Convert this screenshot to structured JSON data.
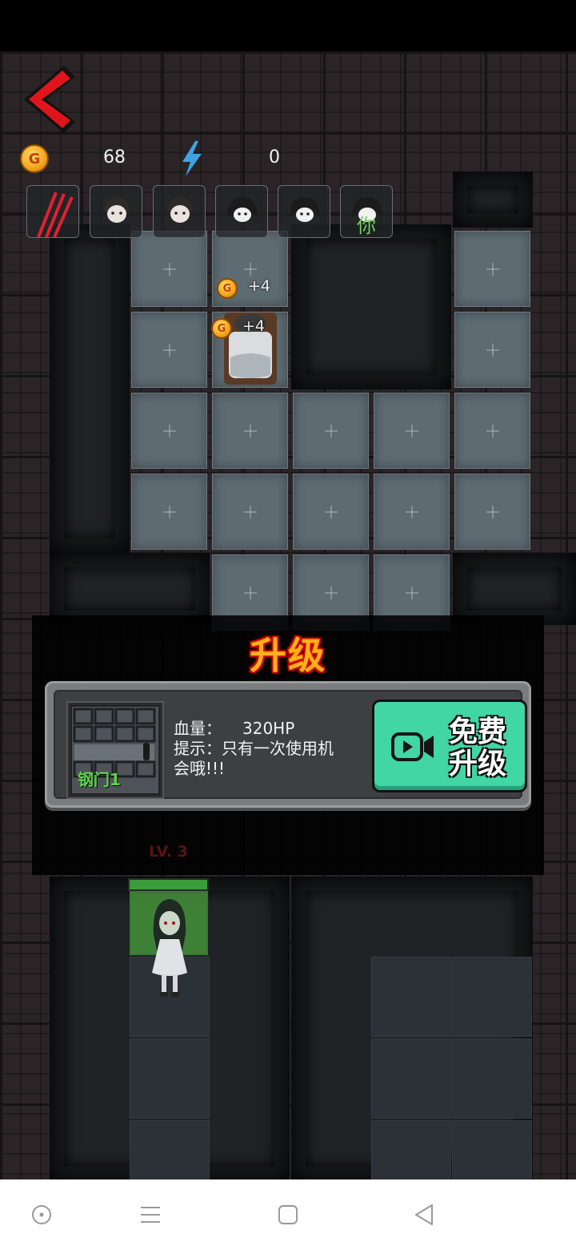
{
  "hud": {
    "coin_icon_label": "G",
    "coins": "68",
    "energy": "0",
    "icons": [
      "back-arrow-icon",
      "coin-icon",
      "lightning-bolt-icon"
    ],
    "character_slots": [
      {
        "icon": "claw-slash-icon"
      },
      {
        "icon": "girl-face-icon"
      },
      {
        "icon": "girl-face-icon"
      },
      {
        "icon": "ghost-face-icon"
      },
      {
        "icon": "ghost-face-icon"
      },
      {
        "icon": "ghost-face-icon",
        "label": "你"
      }
    ]
  },
  "map": {
    "coin_gains": [
      "+4",
      "+4"
    ],
    "small_coin_label": "G"
  },
  "upgrade_dialog": {
    "title": "升级",
    "item_name": "钢门1",
    "hp_label": "血量：",
    "hp_value": "320HP",
    "hint_line1": "提示：只有一次使用机",
    "hint_line2": "会哦!!!",
    "button_line1": "免费",
    "button_line2": "升级"
  },
  "player": {
    "level_label": "LV. 3",
    "hp_fraction": 1.0
  },
  "navbar": {
    "buttons": [
      "record-icon",
      "menu-icon",
      "home-square-icon",
      "back-triangle-icon"
    ]
  },
  "colors": {
    "button_green": "#41d6a4",
    "title_orange": "#ffb11b",
    "item_name_green": "#5fd24a",
    "back_arrow_red": "#e0141b"
  }
}
